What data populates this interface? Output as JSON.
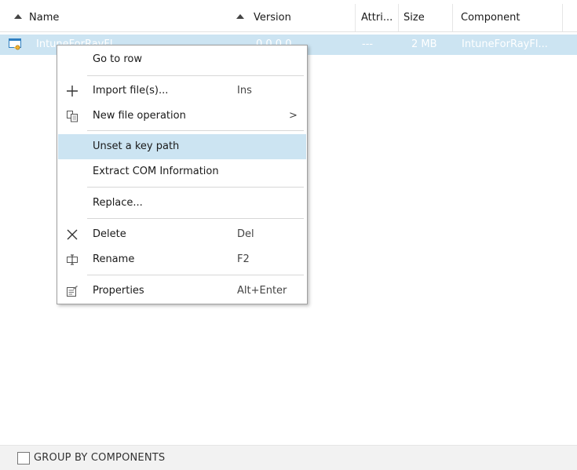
{
  "columns": {
    "name": "Name",
    "version": "Version",
    "attributes": "Attri...",
    "size": "Size",
    "component": "Component"
  },
  "row": {
    "name": "IntuneForRayFl...",
    "version": "0.0.0.0",
    "attributes": "---",
    "size": "2 MB",
    "component": "IntuneForRayFl..."
  },
  "context_menu": {
    "go_to_row": "Go to row",
    "import_files": "Import file(s)...",
    "import_shortcut": "Ins",
    "new_file_operation": "New file operation",
    "submenu_arrow": ">",
    "unset_key_path": "Unset a key path",
    "extract_com": "Extract COM Information",
    "replace": "Replace...",
    "delete": "Delete",
    "delete_shortcut": "Del",
    "rename": "Rename",
    "rename_shortcut": "F2",
    "properties": "Properties",
    "properties_shortcut": "Alt+Enter"
  },
  "footer": {
    "group_by_components": "GROUP BY COMPONENTS",
    "group_by_checked": false
  },
  "colors": {
    "selection": "#cce4f2",
    "header_border": "#e3e3e3",
    "footer_bg": "#f2f2f2"
  }
}
